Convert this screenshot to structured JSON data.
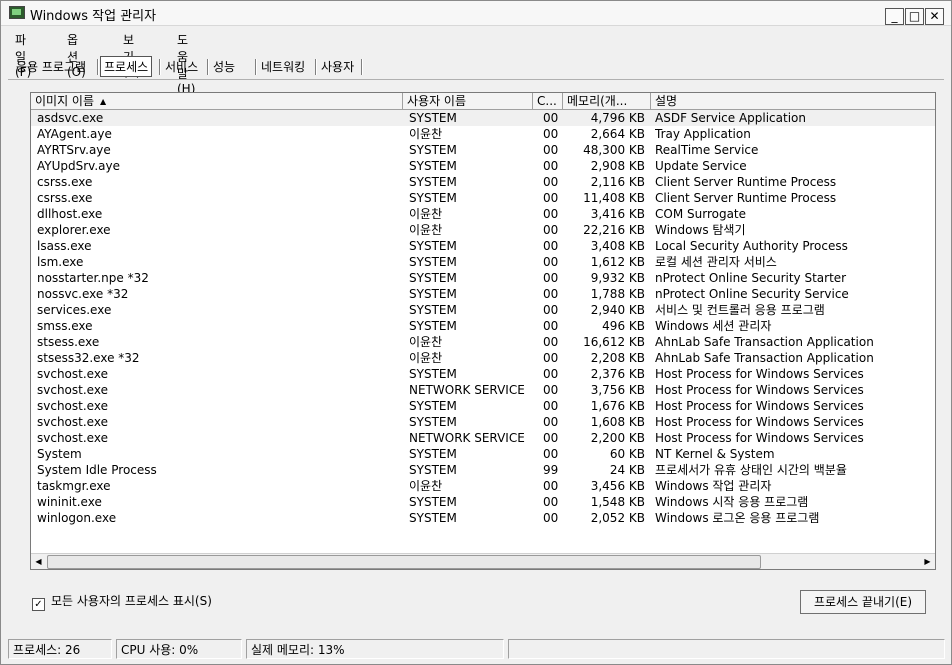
{
  "window": {
    "title": "Windows 작업 관리자",
    "min": "_",
    "max": "□",
    "close": "✕"
  },
  "menu": [
    "파일(F)",
    "옵션(O)",
    "보기(V)",
    "도움말(H)"
  ],
  "tabs": [
    "응용 프로그램",
    "프로세스",
    "서비스",
    "성능",
    "네트워킹",
    "사용자"
  ],
  "columns": {
    "image": "이미지 이름",
    "user": "사용자 이름",
    "cpu": "C...",
    "mem": "메모리(개...",
    "desc": "설명"
  },
  "processes": [
    {
      "image": "asdsvc.exe",
      "user": "SYSTEM",
      "cpu": "00",
      "mem": "4,796 KB",
      "desc": "ASDF Service Application"
    },
    {
      "image": "AYAgent.aye",
      "user": "이윤찬",
      "cpu": "00",
      "mem": "2,664 KB",
      "desc": "Tray Application"
    },
    {
      "image": "AYRTSrv.aye",
      "user": "SYSTEM",
      "cpu": "00",
      "mem": "48,300 KB",
      "desc": "RealTime Service"
    },
    {
      "image": "AYUpdSrv.aye",
      "user": "SYSTEM",
      "cpu": "00",
      "mem": "2,908 KB",
      "desc": "Update Service"
    },
    {
      "image": "csrss.exe",
      "user": "SYSTEM",
      "cpu": "00",
      "mem": "2,116 KB",
      "desc": "Client Server Runtime Process"
    },
    {
      "image": "csrss.exe",
      "user": "SYSTEM",
      "cpu": "00",
      "mem": "11,408 KB",
      "desc": "Client Server Runtime Process"
    },
    {
      "image": "dllhost.exe",
      "user": "이윤찬",
      "cpu": "00",
      "mem": "3,416 KB",
      "desc": "COM Surrogate"
    },
    {
      "image": "explorer.exe",
      "user": "이윤찬",
      "cpu": "00",
      "mem": "22,216 KB",
      "desc": "Windows 탐색기"
    },
    {
      "image": "lsass.exe",
      "user": "SYSTEM",
      "cpu": "00",
      "mem": "3,408 KB",
      "desc": "Local Security Authority Process"
    },
    {
      "image": "lsm.exe",
      "user": "SYSTEM",
      "cpu": "00",
      "mem": "1,612 KB",
      "desc": "로컬 세션 관리자 서비스"
    },
    {
      "image": "nosstarter.npe *32",
      "user": "SYSTEM",
      "cpu": "00",
      "mem": "9,932 KB",
      "desc": "nProtect Online Security Starter"
    },
    {
      "image": "nossvc.exe *32",
      "user": "SYSTEM",
      "cpu": "00",
      "mem": "1,788 KB",
      "desc": "nProtect Online Security Service"
    },
    {
      "image": "services.exe",
      "user": "SYSTEM",
      "cpu": "00",
      "mem": "2,940 KB",
      "desc": "서비스 및 컨트롤러 응용 프로그램"
    },
    {
      "image": "smss.exe",
      "user": "SYSTEM",
      "cpu": "00",
      "mem": "496 KB",
      "desc": "Windows 세션 관리자"
    },
    {
      "image": "stsess.exe",
      "user": "이윤찬",
      "cpu": "00",
      "mem": "16,612 KB",
      "desc": "AhnLab Safe Transaction Application"
    },
    {
      "image": "stsess32.exe *32",
      "user": "이윤찬",
      "cpu": "00",
      "mem": "2,208 KB",
      "desc": "AhnLab Safe Transaction Application"
    },
    {
      "image": "svchost.exe",
      "user": "SYSTEM",
      "cpu": "00",
      "mem": "2,376 KB",
      "desc": "Host Process for Windows Services"
    },
    {
      "image": "svchost.exe",
      "user": "NETWORK SERVICE",
      "cpu": "00",
      "mem": "3,756 KB",
      "desc": "Host Process for Windows Services"
    },
    {
      "image": "svchost.exe",
      "user": "SYSTEM",
      "cpu": "00",
      "mem": "1,676 KB",
      "desc": "Host Process for Windows Services"
    },
    {
      "image": "svchost.exe",
      "user": "SYSTEM",
      "cpu": "00",
      "mem": "1,608 KB",
      "desc": "Host Process for Windows Services"
    },
    {
      "image": "svchost.exe",
      "user": "NETWORK SERVICE",
      "cpu": "00",
      "mem": "2,200 KB",
      "desc": "Host Process for Windows Services"
    },
    {
      "image": "System",
      "user": "SYSTEM",
      "cpu": "00",
      "mem": "60 KB",
      "desc": "NT Kernel & System"
    },
    {
      "image": "System Idle Process",
      "user": "SYSTEM",
      "cpu": "99",
      "mem": "24 KB",
      "desc": "프로세서가 유휴 상태인 시간의 백분율"
    },
    {
      "image": "taskmgr.exe",
      "user": "이윤찬",
      "cpu": "00",
      "mem": "3,456 KB",
      "desc": "Windows 작업 관리자"
    },
    {
      "image": "wininit.exe",
      "user": "SYSTEM",
      "cpu": "00",
      "mem": "1,548 KB",
      "desc": "Windows 시작 응용 프로그램"
    },
    {
      "image": "winlogon.exe",
      "user": "SYSTEM",
      "cpu": "00",
      "mem": "2,052 KB",
      "desc": "Windows 로그온 응용 프로그램"
    }
  ],
  "show_all_label": "모든 사용자의 프로세스 표시(S)",
  "show_all_checked": "✓",
  "end_process_label": "프로세스 끝내기(E)",
  "status": {
    "processes": "프로세스: 26",
    "cpu": "CPU 사용: 0%",
    "memory": "실제 메모리: 13%"
  },
  "icons": {
    "sort": "sort-ascending-icon",
    "scroll_left": "arrow-left-icon",
    "scroll_right": "arrow-right-icon"
  }
}
